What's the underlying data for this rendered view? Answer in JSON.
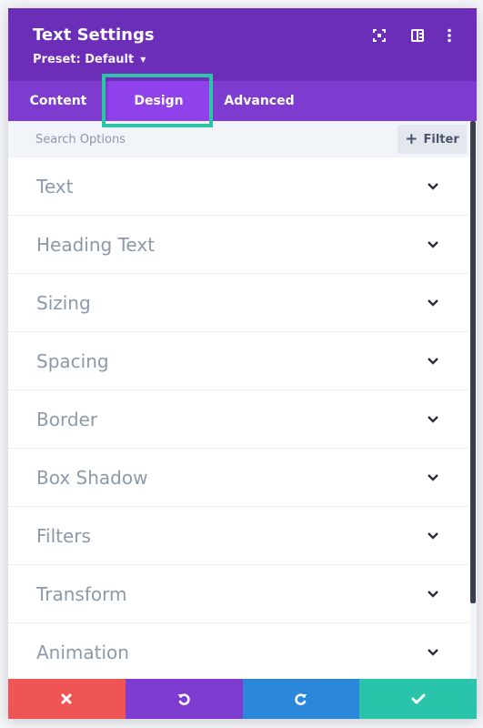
{
  "header": {
    "title": "Text Settings",
    "preset_label": "Preset: Default",
    "icons": [
      "fullscreen-icon",
      "split-view-icon",
      "more-options-icon"
    ]
  },
  "tabs": [
    {
      "label": "Content",
      "active": false
    },
    {
      "label": "Design",
      "active": true
    },
    {
      "label": "Advanced",
      "active": false
    }
  ],
  "search": {
    "placeholder": "Search Options",
    "filter_label": "Filter"
  },
  "sections": [
    {
      "label": "Text"
    },
    {
      "label": "Heading Text"
    },
    {
      "label": "Sizing"
    },
    {
      "label": "Spacing"
    },
    {
      "label": "Border"
    },
    {
      "label": "Box Shadow"
    },
    {
      "label": "Filters"
    },
    {
      "label": "Transform"
    },
    {
      "label": "Animation"
    }
  ],
  "footer": {
    "buttons": [
      {
        "name": "discard",
        "icon": "close-icon",
        "color": "#ef5555"
      },
      {
        "name": "undo",
        "icon": "undo-icon",
        "color": "#7e3bd0"
      },
      {
        "name": "redo",
        "icon": "redo-icon",
        "color": "#2b87da"
      },
      {
        "name": "save",
        "icon": "checkmark-icon",
        "color": "#29c4a9"
      }
    ]
  },
  "colors": {
    "header": "#6c2eb9",
    "tabs": "#7d3bcf",
    "active_tab": "#8f42ec",
    "highlight": "#2ec4a8"
  }
}
